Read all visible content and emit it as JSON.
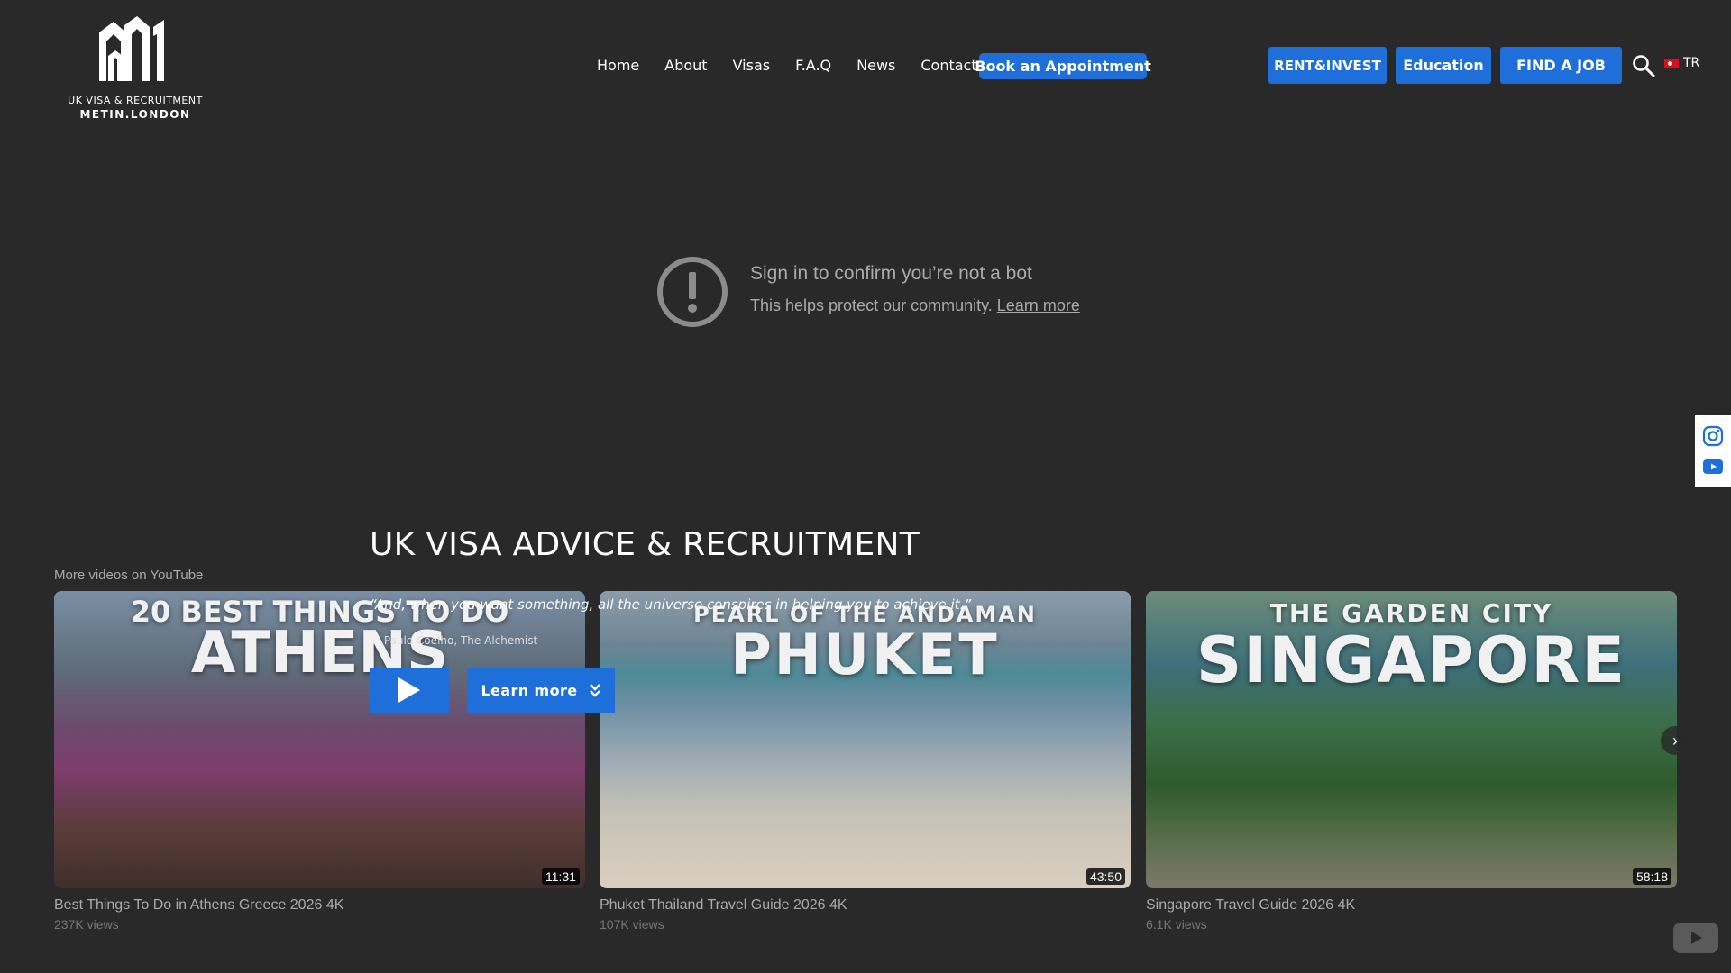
{
  "header": {
    "logo": {
      "line1": "UK VISA & RECRUITMENT",
      "line2": "METIN.LONDON"
    },
    "nav": [
      {
        "label": "Home"
      },
      {
        "label": "About"
      },
      {
        "label": "Visas"
      },
      {
        "label": "F.A.Q"
      },
      {
        "label": "News"
      },
      {
        "label": "Contact"
      }
    ],
    "book_button": "Book an Appointment",
    "buttons": {
      "rent": "RENT&INVEST",
      "education": "Education",
      "job": "FIND A JOB"
    },
    "language": "TR"
  },
  "bot_notice": {
    "title": "Sign in to confirm you’re not a bot",
    "subtitle": "This helps protect our community.",
    "learn_more": "Learn more"
  },
  "section": {
    "title": "UK VISA ADVICE & RECRUITMENT",
    "more_videos": "More videos on YouTube"
  },
  "videos": [
    {
      "thumb_line1": "20 BEST THINGS TO DO",
      "thumb_line2": "ATHENS",
      "title": "Best Things To Do in Athens Greece 2026 4K",
      "views": "237K views",
      "duration": "11:31"
    },
    {
      "thumb_line1": "PEARL OF THE ANDAMAN",
      "thumb_line2": "PHUKET",
      "title": "Phuket Thailand Travel Guide 2026 4K",
      "views": "107K views",
      "duration": "43:50"
    },
    {
      "thumb_line1": "THE GARDEN CITY",
      "thumb_line2": "SINGAPORE",
      "title": "Singapore Travel Guide 2026 4K",
      "views": "6.1K views",
      "duration": "58:18"
    }
  ],
  "overlay": {
    "quote": "“And, when you want something, all the universe conspires in helping you to achieve it.”",
    "author": "— Paulo Coelho, The Alchemist",
    "learn_more": "Learn more"
  },
  "colors": {
    "accent": "#1e6fd9",
    "background": "#292929"
  },
  "icons": [
    "search-icon",
    "instagram-icon",
    "youtube-icon",
    "play-icon",
    "chevron-double-down-icon",
    "chevron-right-icon",
    "exclamation-circle-icon"
  ]
}
